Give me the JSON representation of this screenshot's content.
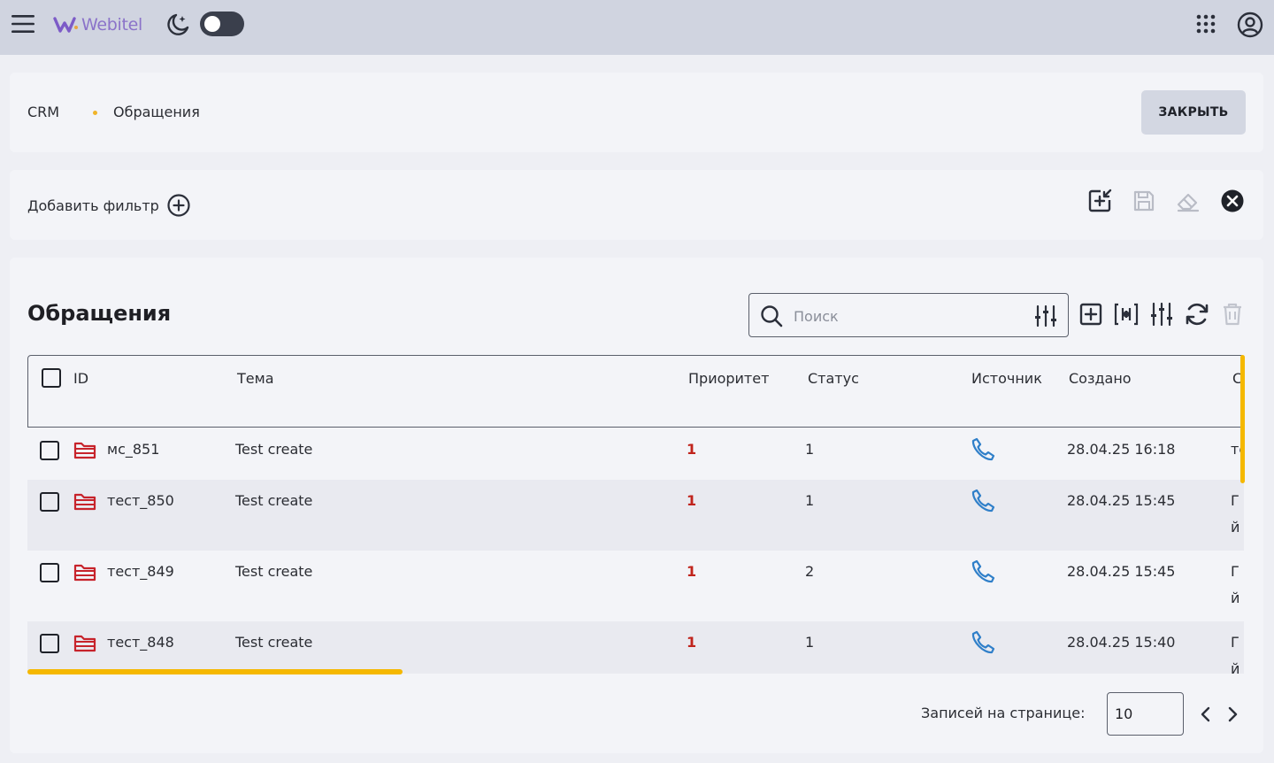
{
  "topbar": {
    "logo_text": "Webitel",
    "theme_toggle_on": false,
    "brand_color": "#8b73c9"
  },
  "breadcrumb": {
    "root": "CRM",
    "current": "Обращения"
  },
  "header": {
    "close_label": "ЗАКРЫТЬ"
  },
  "filters": {
    "add_filter_label": "Добавить фильтр"
  },
  "main": {
    "title": "Обращения",
    "search": {
      "placeholder": "Поиск",
      "value": ""
    },
    "columns": [
      "ID",
      "Тема",
      "Приоритет",
      "Статус",
      "Источник",
      "Создано",
      "С"
    ],
    "rows": [
      {
        "id": "мс_851",
        "subject": "Test create",
        "priority": "1",
        "status": "1",
        "source_icon": "phone-icon",
        "created": "28.04.25 16:18",
        "extra": "те",
        "extra2": ""
      },
      {
        "id": "тест_850",
        "subject": "Test create",
        "priority": "1",
        "status": "1",
        "source_icon": "phone-icon",
        "created": "28.04.25 15:45",
        "extra": "Г",
        "extra2": "й"
      },
      {
        "id": "тест_849",
        "subject": "Test create",
        "priority": "1",
        "status": "2",
        "source_icon": "phone-icon",
        "created": "28.04.25 15:45",
        "extra": "Г",
        "extra2": "й"
      },
      {
        "id": "тест_848",
        "subject": "Test create",
        "priority": "1",
        "status": "1",
        "source_icon": "phone-icon",
        "created": "28.04.25 15:40",
        "extra": "Г",
        "extra2": "й"
      }
    ]
  },
  "pagination": {
    "per_page_label": "Записей на странице:",
    "per_page_value": "10"
  },
  "colors": {
    "accent": "#f5b800",
    "priority_high": "#c0241c",
    "phone": "#2f7fc9",
    "folder": "#c7232b"
  }
}
